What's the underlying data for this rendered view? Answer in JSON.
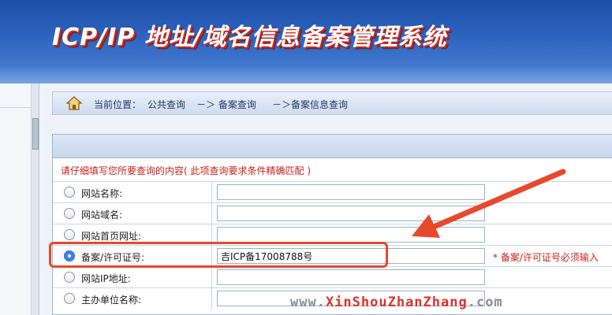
{
  "header": {
    "title": "ICP/IP 地址/域名信息备案管理系统"
  },
  "breadcrumb": {
    "label": "当前位置：",
    "items": [
      "公共查询",
      "－＞ 备案查询",
      "－＞备案信息查询"
    ]
  },
  "form": {
    "instructions": "请仔细填写您所要查询的内容( 此项查询要求条件精确匹配 )",
    "rows": [
      {
        "label": "网站名称:",
        "value": "",
        "checked": false
      },
      {
        "label": "网站域名:",
        "value": "",
        "checked": false
      },
      {
        "label": "网站首页网址:",
        "value": "",
        "checked": false
      },
      {
        "label": "备案/许可证号:",
        "value": "吉ICP备17008788号",
        "checked": true,
        "note": "* 备案/许可证号必须输入"
      },
      {
        "label": "网站IP地址:",
        "value": "",
        "checked": false
      },
      {
        "label": "主办单位名称:",
        "value": "",
        "checked": false
      }
    ]
  },
  "annotation": {
    "highlight_color": "#e8482c",
    "arrow_color": "#e8482c"
  },
  "watermark": {
    "part1": "www.",
    "part2": "XinShouZhanZhang",
    "part3": ".com"
  }
}
